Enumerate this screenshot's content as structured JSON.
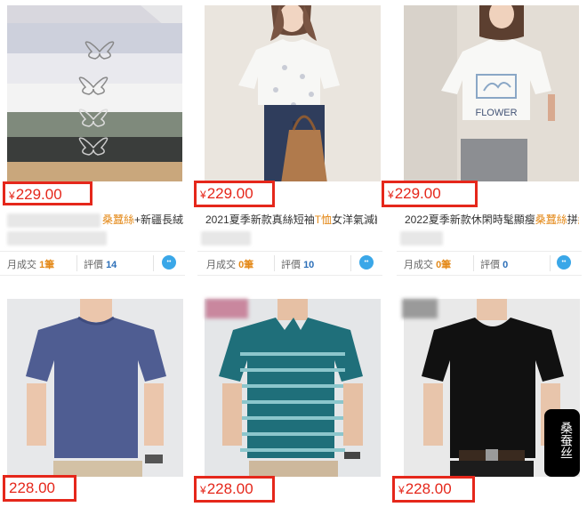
{
  "products": [
    {
      "price": "229.00",
      "currency": "¥",
      "title_pre": "",
      "title_hl": "桑蠶絲",
      "title_post": "+新疆長絨",
      "sales_label": "月成交",
      "sales_value": "1筆",
      "review_label": "評價",
      "review_value": "14"
    },
    {
      "price": "229.00",
      "currency": "¥",
      "title_pre": "2021夏季新款真絲短袖",
      "title_hl": "T恤",
      "title_post": "女洋氣減齡",
      "sales_label": "月成交",
      "sales_value": "0筆",
      "review_label": "評價",
      "review_value": "10"
    },
    {
      "price": "229.00",
      "currency": "¥",
      "title_pre": "2022夏季新款休閑時髦顯瘦",
      "title_hl": "桑蠶絲",
      "title_post": "拼",
      "title_hl2": "絲",
      "sales_label": "月成交",
      "sales_value": "0筆",
      "review_label": "評價",
      "review_value": "0"
    },
    {
      "price": "228.00",
      "currency": "¥"
    },
    {
      "price": "228.00",
      "currency": "¥"
    },
    {
      "price": "228.00",
      "currency": "¥",
      "watermark": "桑蚕丝"
    }
  ],
  "shirt_print_text": "FLOWER",
  "chat_icon": "chat-bubble-icon",
  "colors": {
    "price_red": "#e5271b",
    "highlight_orange": "#e48a1a",
    "review_blue": "#2c6fb8",
    "chat_blue": "#3aa7e8"
  }
}
